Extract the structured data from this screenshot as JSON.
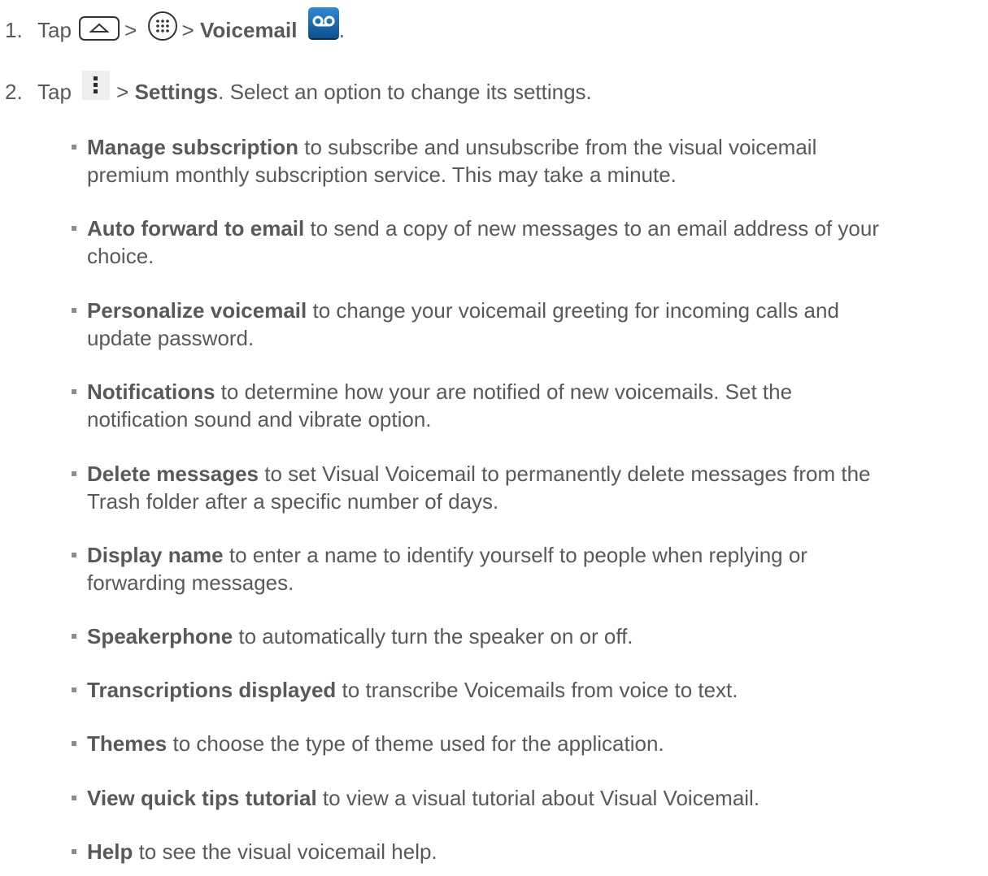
{
  "step1": {
    "number": "1.",
    "tap": "Tap",
    "sep1": ">",
    "sep2": ">",
    "target": "Voicemail",
    "end": ".",
    "icons": [
      "home-button-icon",
      "apps-button-icon",
      "voicemail-app-icon"
    ]
  },
  "step2": {
    "number": "2.",
    "tap": "Tap",
    "sep": ">",
    "target": "Settings",
    "rest": ". Select an option to change its settings.",
    "icons": [
      "menu-icon"
    ]
  },
  "options": [
    {
      "name": "Manage subscription",
      "line1": " to subscribe and unsubscribe from the visual voicemail",
      "line2": "premium monthly subscription service. This may take a minute."
    },
    {
      "name": "Auto forward to email",
      "line1": " to send a copy of new messages to an email address of your",
      "line2": "choice."
    },
    {
      "name": "Personalize voicemail",
      "line1": " to change your voicemail greeting for incoming calls and",
      "line2": "update password."
    },
    {
      "name": "Notifications",
      "line1": " to determine how your are notified of new voicemails. Set the",
      "line2": "notification sound and vibrate option."
    },
    {
      "name": "Delete messages",
      "line1": " to set Visual Voicemail to permanently delete messages from the",
      "line2": "Trash folder after a specific number of days."
    },
    {
      "name": "Display name",
      "line1": " to enter a name to identify yourself to people when replying or",
      "line2": "forwarding messages."
    },
    {
      "name": "Speakerphone",
      "line1": " to automatically turn the speaker on or off.",
      "line2": ""
    },
    {
      "name": "Transcriptions displayed",
      "line1": " to transcribe Voicemails from voice to text.",
      "line2": ""
    },
    {
      "name": "Themes",
      "line1": " to choose the type of theme used for the application.",
      "line2": ""
    },
    {
      "name": "View quick tips tutorial",
      "line1": " to view a visual tutorial about Visual Voicemail.",
      "line2": ""
    },
    {
      "name": "Help",
      "line1": " to see the visual voicemail help.",
      "line2": ""
    }
  ],
  "colors": {
    "text": "#595959",
    "bullet": "#8c8c8c",
    "voicemail_icon": "#1f6db3"
  }
}
